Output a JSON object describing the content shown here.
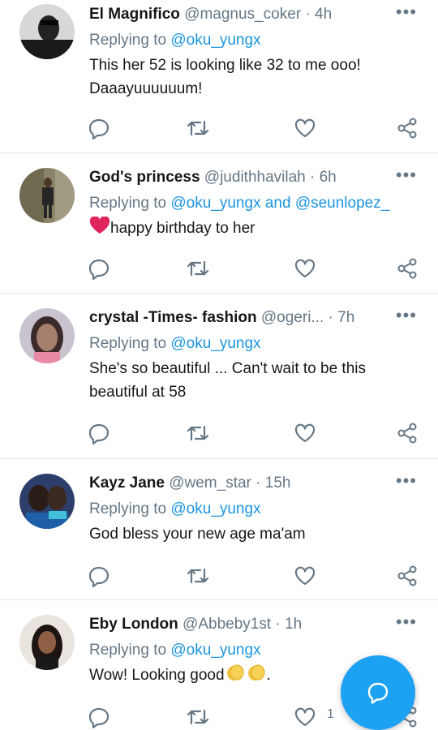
{
  "tweets": [
    {
      "name": "El Magnifico",
      "handle": "@magnus_coker",
      "sep": " · ",
      "time": "4h",
      "replying_prefix": "Replying to ",
      "replying_to": "@oku_yungx",
      "replying_and": "",
      "replying_to2": "",
      "text_lines": [
        "This her 52 is looking like 32 to me ooo!",
        "Daaayuuuuuum!"
      ],
      "like_count": ""
    },
    {
      "name": "God's princess",
      "handle": "@judithhavilah",
      "sep": " · ",
      "time": "6h",
      "replying_prefix": "Replying to ",
      "replying_to": "@oku_yungx",
      "replying_and": " and ",
      "replying_to2": "@seunlopez_",
      "text_lines": [
        "happy birthday to her"
      ],
      "like_count": ""
    },
    {
      "name": "crystal -Times- fashion",
      "handle": "@ogeri...",
      "sep": " · ",
      "time": "7h",
      "replying_prefix": "Replying to ",
      "replying_to": "@oku_yungx",
      "replying_and": "",
      "replying_to2": "",
      "text_lines": [
        "She's so beautiful ... Can't wait to be this",
        "beautiful at 58"
      ],
      "like_count": ""
    },
    {
      "name": "Kayz Jane",
      "handle": "@wem_star",
      "sep": " · ",
      "time": "15h",
      "replying_prefix": "Replying to ",
      "replying_to": "@oku_yungx",
      "replying_and": "",
      "replying_to2": "",
      "text_lines": [
        "God bless your new age ma'am"
      ],
      "like_count": ""
    },
    {
      "name": "Eby London",
      "handle": "@Abbeby1st",
      "sep": " · ",
      "time": "1h",
      "replying_prefix": "Replying to ",
      "replying_to": "@oku_yungx",
      "replying_and": "",
      "replying_to2": "",
      "text_lines": [
        "Wow! Looking good",
        "."
      ],
      "like_count": "1"
    }
  ],
  "more_label": "•••",
  "icons": {
    "reply": "reply-icon",
    "retweet": "retweet-icon",
    "like": "heart-icon",
    "share": "share-icon",
    "more": "more-options-icon",
    "compose": "compose-reply-icon",
    "heart_emoji": "red-heart-emoji",
    "clap_emoji": "clapping-hands-emoji"
  },
  "colors": {
    "accent": "#1da1f2",
    "mention": "#1b95e0",
    "muted": "#657786",
    "heart_emoji": "#e0245e",
    "clap_emoji": "#f5c542"
  }
}
